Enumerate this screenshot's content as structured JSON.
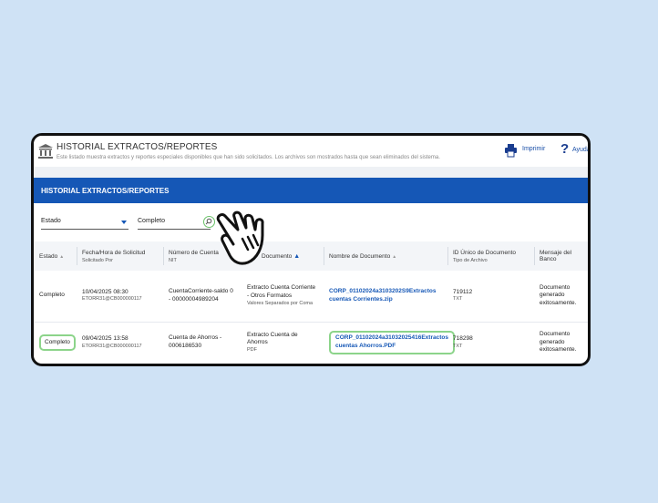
{
  "header": {
    "title": "HISTORIAL EXTRACTOS/REPORTES",
    "subtitle": "Este listado muestra extractos y reportes especiales disponibles que han sido solicitados. Los archivos son mostrados hasta que sean eliminados del sistema.",
    "print_label": "Imprimir",
    "help_label": "Ayuda"
  },
  "section": {
    "title": "HISTORIAL EXTRACTOS/REPORTES"
  },
  "filters": {
    "field_value": "Estado",
    "search_value": "Completo"
  },
  "table": {
    "headers": {
      "estado": "Estado",
      "fecha": "Fecha/Hora de Solicitud",
      "fecha_sub": "Solicitado Por",
      "numero": "Número de Cuenta",
      "numero_sub": "NIT",
      "tipo": "Documento",
      "nombre": "Nombre de Documento",
      "id": "ID Único de Documento",
      "id_sub": "Tipo de Archivo",
      "mensaje": "Mensaje del Banco"
    },
    "rows": [
      {
        "estado": "Completo",
        "fecha": "10/04/2025 08:30",
        "solicitado_por": "ETORR31@CB000000117",
        "cuenta": "CuentaCorriente-saldo 0 - 00000004989204",
        "tipo": "Extracto Cuenta Corriente - Otros Formatos",
        "tipo_sub": "Valores Separados por Coma",
        "nombre": "CORP_01102024a3103202S9Extractos cuentas Corrientes.zip",
        "id": "719112",
        "tipo_archivo": "TXT",
        "mensaje": "Documento generado exitosamente."
      },
      {
        "estado": "Completo",
        "fecha": "09/04/2025 13:58",
        "solicitado_por": "ETORR31@CB000000117",
        "cuenta": "Cuenta de Ahorros - 0006186530",
        "tipo": "Extracto Cuenta de Ahorros",
        "tipo_sub": "PDF",
        "nombre": "CORP_01102024a31032025416Extractos cuentas Ahorros.PDF",
        "id": "718298",
        "tipo_archivo": "TXT",
        "mensaje": "Documento generado exitosamente."
      }
    ]
  },
  "icons": [
    "bank-icon",
    "print-icon",
    "help-icon",
    "search-icon",
    "sort-icon",
    "hand-pointer-icon"
  ],
  "colors": {
    "primary_blue": "#1557b6",
    "highlight_green": "#8cd48a",
    "background": "#cfe2f5"
  }
}
